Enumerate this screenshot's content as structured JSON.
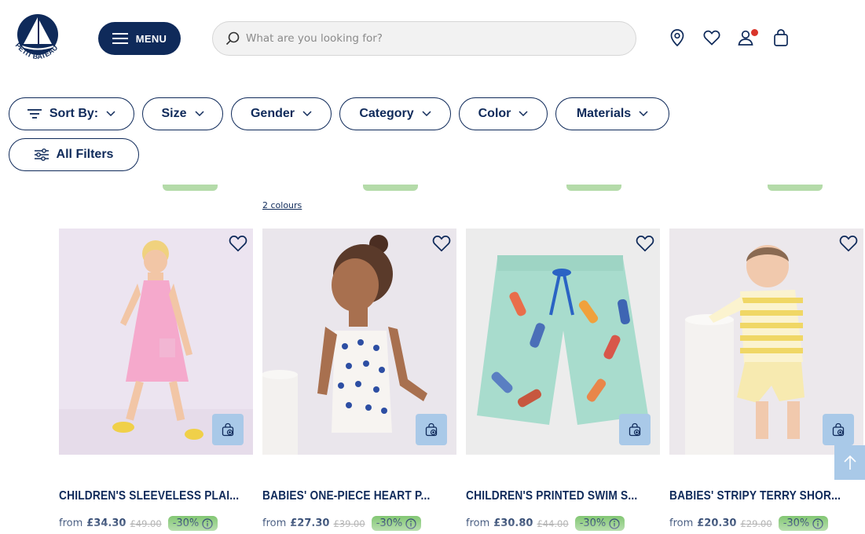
{
  "header": {
    "brand": "PETIT BATEAU",
    "menu_label": "MENU",
    "search_placeholder": "What are you looking for?",
    "icons": [
      "location-icon",
      "heart-icon",
      "account-icon",
      "bag-icon"
    ]
  },
  "filters": [
    {
      "label": "Sort By:",
      "icon": "sort-icon"
    },
    {
      "label": "Size"
    },
    {
      "label": "Gender"
    },
    {
      "label": "Category"
    },
    {
      "label": "Color"
    },
    {
      "label": "Materials"
    },
    {
      "label": "All Filters",
      "icon": "sliders-icon"
    }
  ],
  "previous_row": {
    "colours_link": "2 colours"
  },
  "products": [
    {
      "title": "CHILDREN'S SLEEVELESS PLAI...",
      "from": "from",
      "price": "£34.30",
      "was": "£49.00",
      "discount": "-30%"
    },
    {
      "title": "BABIES' ONE-PIECE HEART P...",
      "from": "from",
      "price": "£27.30",
      "was": "£39.00",
      "discount": "-30%"
    },
    {
      "title": "CHILDREN'S PRINTED SWIM S...",
      "from": "from",
      "price": "£30.80",
      "was": "£44.00",
      "discount": "-30%"
    },
    {
      "title": "BABIES' STRIPY TERRY SHOR...",
      "from": "from",
      "price": "£20.30",
      "was": "£29.00",
      "discount": "-30%"
    }
  ],
  "colors": {
    "navy": "#0f2a5a",
    "discount_green": "#7ac36a",
    "bag_blue": "#a9c9e8"
  }
}
